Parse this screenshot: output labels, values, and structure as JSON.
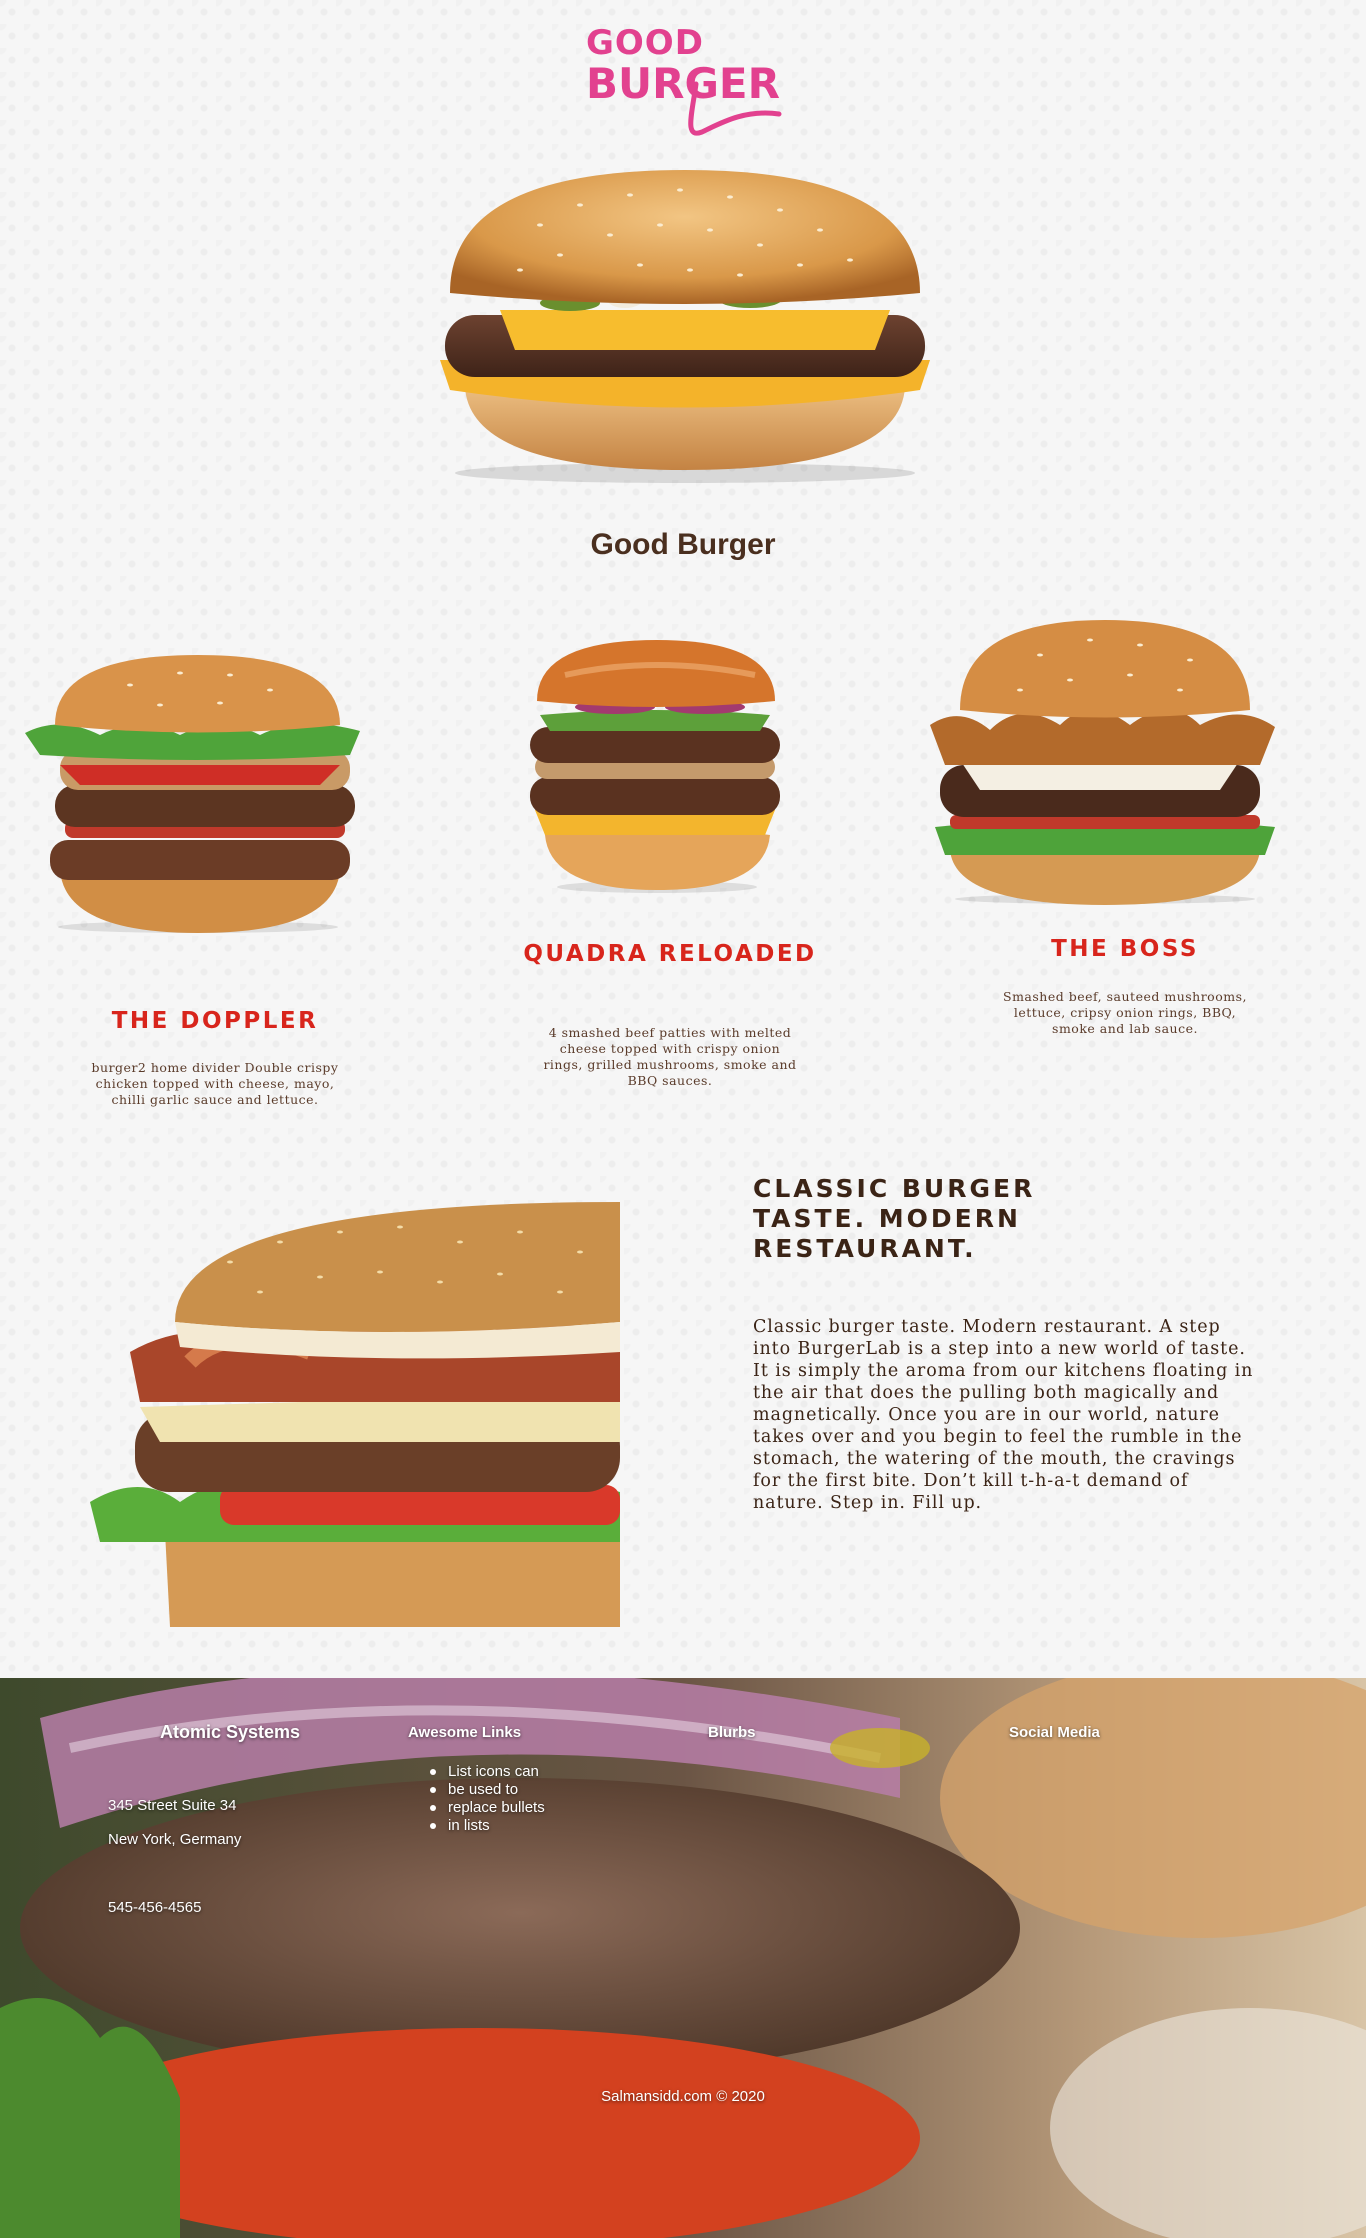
{
  "brand": {
    "logo_word_top": "GOOD",
    "logo_word_bottom": "BURGER",
    "logo_color": "#e2418f",
    "site_title": "Good Burger"
  },
  "menu": [
    {
      "title": "THE DOPPLER",
      "description": "burger2 home divider Double crispy chicken topped with cheese, mayo, chilli garlic sauce and lettuce."
    },
    {
      "title": "QUADRA RELOADED",
      "description": "4 smashed beef patties with melted cheese topped with crispy onion rings, grilled mushrooms, smoke and BBQ sauces."
    },
    {
      "title": "THE BOSS",
      "description": "Smashed beef, sauteed mushrooms, lettuce, cripsy onion rings, BBQ, smoke and lab sauce."
    }
  ],
  "about": {
    "heading": "CLASSIC BURGER TASTE. MODERN RESTAURANT.",
    "text": "Classic burger taste. Modern restaurant. A step into BurgerLab is a step into a new world of taste. It is simply the aroma from our kitchens floating in the air that does the pulling both magically and magnetically. Once you are in our world, nature takes over and you begin to feel the rumble in the stomach, the watering of the mouth, the cravings for the first bite. Don’t kill t-h-a-t demand of nature. Step in. Fill up."
  },
  "footer": {
    "col1_title": "Atomic Systems",
    "address_line1": "345 Street Suite 34",
    "address_line2": "New York, Germany",
    "phone": "545-456-4565",
    "col2_title": "Awesome Links",
    "links": [
      "List icons can",
      "be used to",
      "replace bullets",
      "in lists"
    ],
    "col3_title": "Blurbs",
    "col4_title": "Social Media",
    "copyright": "Salmansidd.com © 2020"
  },
  "colors": {
    "accent_red": "#d8251c",
    "text_brown": "#4a2f1f",
    "background": "#f6f6f6"
  }
}
